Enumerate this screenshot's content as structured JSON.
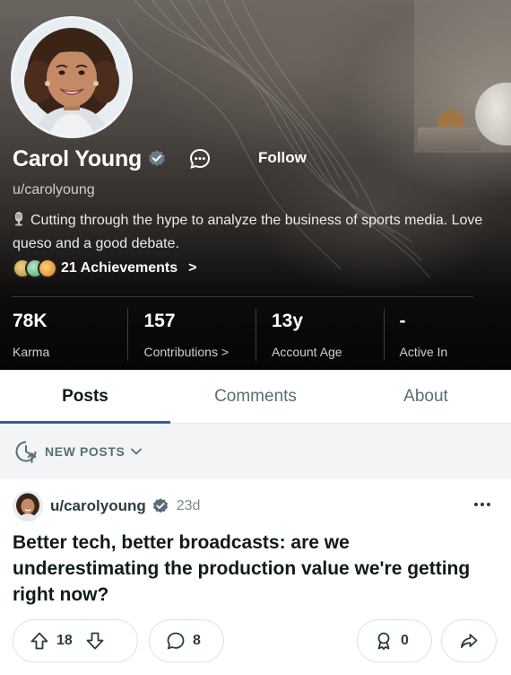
{
  "profile": {
    "display_name": "Carol Young",
    "username": "u/carolyoung",
    "bio": "Cutting through the hype to analyze the business of sports media. Love queso and a good debate.",
    "follow_label": "Follow",
    "achievements_label": "21 Achievements",
    "achievements_chevron": ">"
  },
  "stats": [
    {
      "value": "78K",
      "label": "Karma"
    },
    {
      "value": "157",
      "label": "Contributions >"
    },
    {
      "value": "13y",
      "label": "Account Age"
    },
    {
      "value": "-",
      "label": "Active In"
    }
  ],
  "tabs": [
    {
      "label": "Posts",
      "active": true
    },
    {
      "label": "Comments",
      "active": false
    },
    {
      "label": "About",
      "active": false
    }
  ],
  "sort": {
    "label": "NEW POSTS"
  },
  "post": {
    "author": "u/carolyoung",
    "age": "23d",
    "title": "Better tech, better broadcasts: are we underestimating the production value we're getting right now?",
    "upvotes": "18",
    "comments": "8",
    "awards": "0"
  },
  "colors": {
    "active_tab_indicator": "#3b5ba9",
    "sort_bar_background": "#f2f4f5",
    "verified_badge": "#5b6b7a"
  },
  "icons": {
    "verified": "verified-badge-icon",
    "chat": "chat-bubble-icon",
    "bio_emoji": "microphone-icon",
    "sort": "clock-arrow-icon",
    "chevron": "chevron-down-icon",
    "more": "more-horizontal-icon",
    "upvote": "arrow-up-icon",
    "downvote": "arrow-down-icon",
    "comment": "comment-bubble-icon",
    "award": "award-icon",
    "share": "share-arrow-icon"
  }
}
